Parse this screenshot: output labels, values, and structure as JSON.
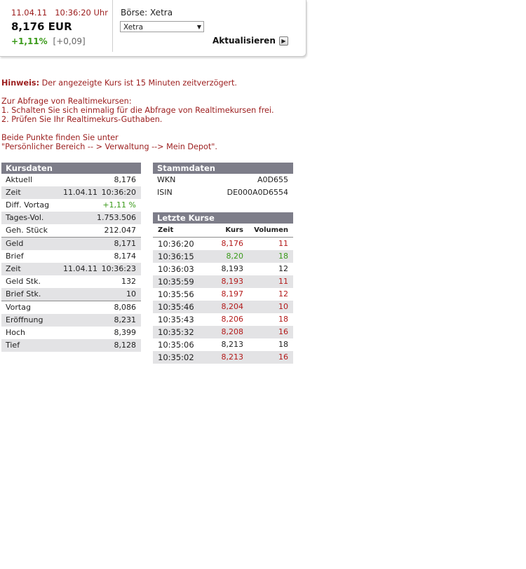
{
  "quote": {
    "date": "11.04.11",
    "time": "10:36:20 Uhr",
    "price": "8,176 EUR",
    "change_pct": "+1,11%",
    "change_abs": "[+0,09]",
    "exchange_label": "Börse: Xetra",
    "exchange_selected": "Xetra",
    "refresh_label": "Aktualisieren"
  },
  "notice": {
    "hint_label": "Hinweis:",
    "hint_text": " Der angezeigte Kurs ist 15 Minuten zeitverzögert.",
    "realtime_intro": "Zur Abfrage von Realtimekursen:",
    "step1": "1. Schalten Sie sich einmalig für die Abfrage von Realtimekursen frei.",
    "step2": "2. Prüfen Sie Ihr Realtimekurs-Guthaben.",
    "find_intro": "Beide Punkte finden Sie unter",
    "find_path": "\"Persönlicher Bereich -- > Verwaltung --> Mein Depot\"."
  },
  "kursdaten": {
    "title": "Kursdaten",
    "rows": [
      {
        "label": "Aktuell",
        "mid": "",
        "value": "8,176"
      },
      {
        "label": "Zeit",
        "mid": "11.04.11",
        "value": "10:36:20"
      },
      {
        "label": "Diff. Vortag",
        "mid": "",
        "value": "+1,11 %"
      },
      {
        "label": "Tages-Vol.",
        "mid": "",
        "value": "1.753.506"
      },
      {
        "label": "Geh. Stück",
        "mid": "",
        "value": "212.047"
      },
      {
        "label": "Geld",
        "mid": "",
        "value": "8,171"
      },
      {
        "label": "Brief",
        "mid": "",
        "value": "8,174"
      },
      {
        "label": "Zeit",
        "mid": "11.04.11",
        "value": "10:36:23"
      },
      {
        "label": "Geld Stk.",
        "mid": "",
        "value": "132"
      },
      {
        "label": "Brief Stk.",
        "mid": "",
        "value": "10"
      },
      {
        "label": "Vortag",
        "mid": "",
        "value": "8,086"
      },
      {
        "label": "Eröffnung",
        "mid": "",
        "value": "8,231"
      },
      {
        "label": "Hoch",
        "mid": "",
        "value": "8,399"
      },
      {
        "label": "Tief",
        "mid": "",
        "value": "8,128"
      }
    ]
  },
  "stammdaten": {
    "title": "Stammdaten",
    "rows": [
      {
        "label": "WKN",
        "value": "A0D655"
      },
      {
        "label": "ISIN",
        "value": "DE000A0D6554"
      }
    ]
  },
  "letzte_kurse": {
    "title": "Letzte Kurse",
    "headers": {
      "time": "Zeit",
      "kurs": "Kurs",
      "volume": "Volumen"
    },
    "rows": [
      {
        "time": "10:36:20",
        "kurs": "8,176",
        "volume": "11",
        "color": "#b31919"
      },
      {
        "time": "10:36:15",
        "kurs": "8,20",
        "volume": "18",
        "color": "#3a9a1a"
      },
      {
        "time": "10:36:03",
        "kurs": "8,193",
        "volume": "12",
        "color": "#222222"
      },
      {
        "time": "10:35:59",
        "kurs": "8,193",
        "volume": "11",
        "color": "#b31919"
      },
      {
        "time": "10:35:56",
        "kurs": "8,197",
        "volume": "12",
        "color": "#b31919"
      },
      {
        "time": "10:35:46",
        "kurs": "8,204",
        "volume": "10",
        "color": "#b31919"
      },
      {
        "time": "10:35:43",
        "kurs": "8,206",
        "volume": "18",
        "color": "#b31919"
      },
      {
        "time": "10:35:32",
        "kurs": "8,208",
        "volume": "16",
        "color": "#b31919"
      },
      {
        "time": "10:35:06",
        "kurs": "8,213",
        "volume": "18",
        "color": "#222222"
      },
      {
        "time": "10:35:02",
        "kurs": "8,213",
        "volume": "16",
        "color": "#b31919"
      }
    ]
  },
  "colors": {
    "accent_red": "#9b1c1c",
    "up_green": "#3a9a1a",
    "panel_header": "#7d7d89",
    "row_alt": "#e3e3e5"
  }
}
